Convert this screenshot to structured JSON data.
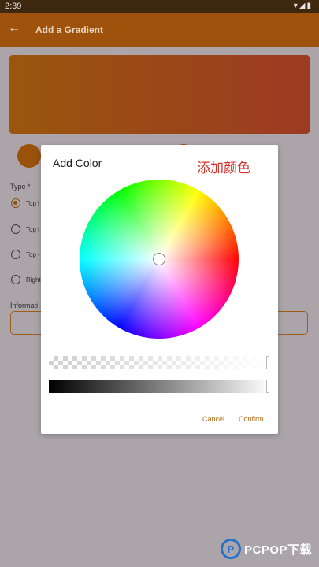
{
  "status_bar": {
    "time": "2:39",
    "icons": [
      "wifi-icon",
      "signal-icon",
      "battery-icon"
    ]
  },
  "app_bar": {
    "title": "Add a Gradient",
    "back_icon": "arrow-left-icon"
  },
  "form": {
    "type_label": "Type *",
    "radio_options": [
      {
        "label": "Top l",
        "checked": true
      },
      {
        "label": "Top l",
        "checked": false
      },
      {
        "label": "Top -",
        "checked": false
      },
      {
        "label": "Right",
        "checked": false
      }
    ],
    "info_label": "Informati"
  },
  "dialog": {
    "title": "Add Color",
    "annotation": "添加颜色",
    "buttons": {
      "cancel": "Cancel",
      "confirm": "Confirm"
    }
  },
  "watermark": {
    "logo": "P",
    "text": "PCPOP下载"
  },
  "colors": {
    "app_bar": "#9e520b",
    "accent": "#b36b16",
    "gradient_start": "#9a560d",
    "gradient_end": "#9c3a22",
    "annotation": "#d4332c"
  }
}
